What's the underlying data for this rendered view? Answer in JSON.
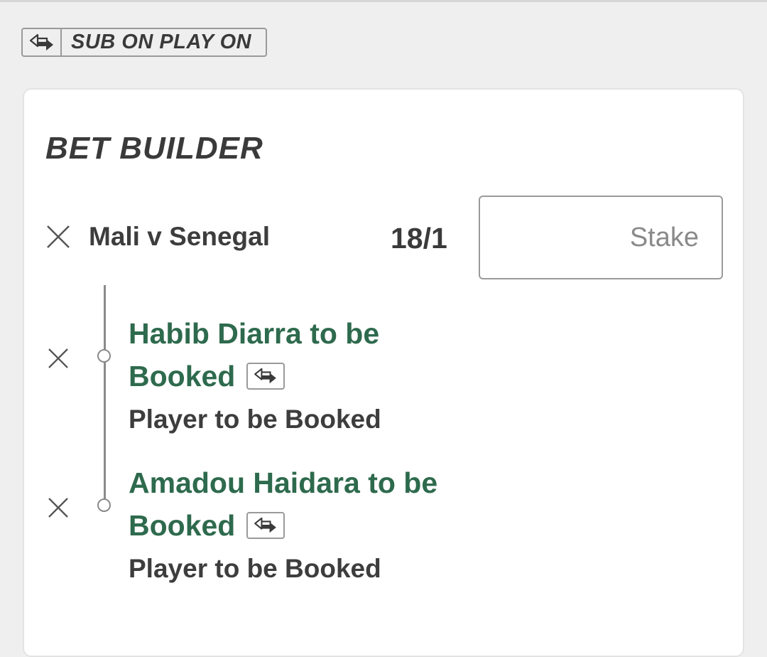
{
  "sub_badge": {
    "label": "SUB ON PLAY ON",
    "icon": "swap-arrows-icon"
  },
  "card": {
    "title": "BET BUILDER",
    "match": "Mali v Senegal",
    "odds": "18/1",
    "stake_placeholder": "Stake",
    "stake_value": "",
    "selections": [
      {
        "title": "Habib Diarra to be Booked",
        "line1": "Habib Diarra to be",
        "line2": "Booked",
        "market": "Player to be Booked",
        "icon": "swap-arrows-icon"
      },
      {
        "title": "Amadou Haidara to be Booked",
        "line1": "Amadou Haidara to be",
        "line2": "Booked",
        "market": "Player to be Booked",
        "icon": "swap-arrows-icon"
      }
    ]
  },
  "colors": {
    "selection_green": "#2e6a4d",
    "text_dark": "#3a3a3a",
    "border_gray": "#9a9a9a",
    "background": "#efefef"
  }
}
